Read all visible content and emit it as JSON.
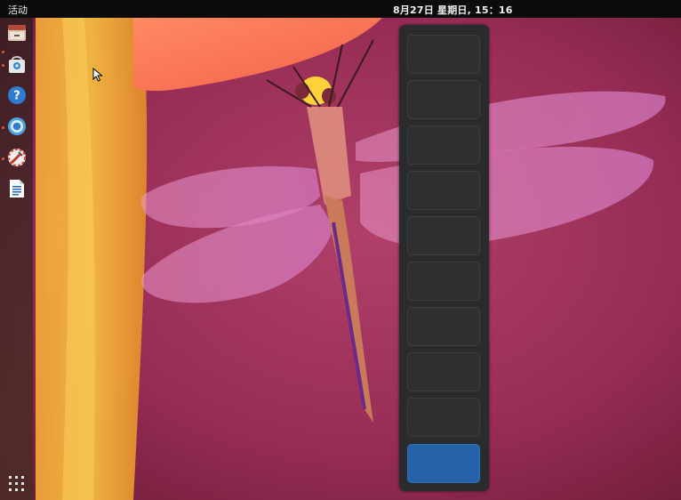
{
  "topbar": {
    "activities_label": "活动",
    "clock_text": "8月27日 星期日, 15：16"
  },
  "dock": {
    "items": [
      {
        "name": "file-cabinet-icon",
        "running": true
      },
      {
        "name": "software-store-icon",
        "running": true
      },
      {
        "name": "help-icon",
        "running": false
      },
      {
        "name": "chrome-icon",
        "running": true
      },
      {
        "name": "system-tools-icon",
        "running": true
      },
      {
        "name": "text-editor-icon",
        "running": false
      }
    ],
    "show_apps_icon": "apps-grid-icon"
  },
  "workspaces": {
    "count": 10,
    "active_index": 9
  },
  "colors": {
    "accent": "#2662a8",
    "wallpaper_base": "#8a2346"
  }
}
